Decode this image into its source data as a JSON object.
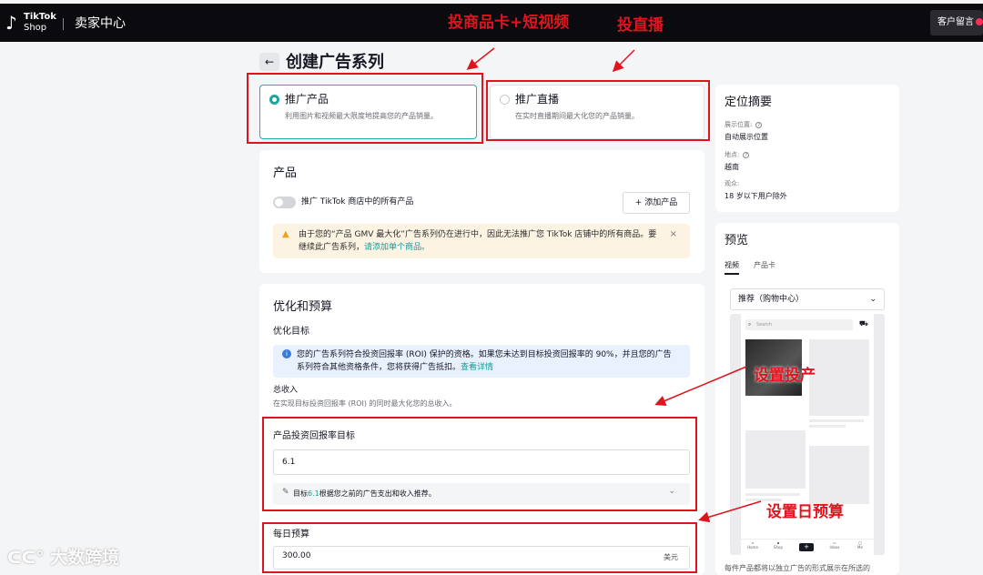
{
  "topbar": {
    "brand_top": "TikTok",
    "brand_bottom": "Shop",
    "portal": "卖家中心",
    "service": "客户留言"
  },
  "page": {
    "back_icon": "←",
    "title": "创建广告系列"
  },
  "objectives": [
    {
      "title": "推广产品",
      "desc": "利用图片和视频最大限度地提高您的产品销量。"
    },
    {
      "title": "推广直播",
      "desc": "在实时直播期间最大化您的产品销量。"
    }
  ],
  "products": {
    "title": "产品",
    "toggle_label": "推广 TikTok 商店中的所有产品",
    "add_button": "+ 添加产品",
    "warning_text": "由于您的“产品 GMV 最大化”广告系列仍在进行中，因此无法推广您 TikTok 店铺中的所有商品。要继续此广告系列，",
    "warning_link": "请添加单个商品。"
  },
  "budget": {
    "title": "优化和预算",
    "goal_label": "优化目标",
    "info_text": "您的广告系列符合投资回报率 (ROI) 保护的资格。如果您未达到目标投资回报率的 90%，并且您的广告系列符合其他资格条件，您将获得广告抵扣。",
    "info_link": "查看详情",
    "total_label": "总收入",
    "total_desc": "在实现目标投资回报率 (ROI) 的同时最大化您的总收入。",
    "roi_label": "产品投资回报率目标",
    "roi_value": "6.1",
    "rec_prefix": "目标",
    "rec_value": "6.1",
    "rec_suffix": "根据您之前的广告支出和收入推荐。",
    "daily_label": "每日预算",
    "daily_value": "300.00",
    "currency": "美元"
  },
  "summary": {
    "title": "定位摘要",
    "placement_label": "展示位置:",
    "placement_value": "自动展示位置",
    "location_label": "地点:",
    "location_value": "越南",
    "audience_label": "观众:",
    "audience_value": "18 岁以下用户除外"
  },
  "preview": {
    "title": "预览",
    "tabs": [
      "视频",
      "产品卡"
    ],
    "select_value": "推荐（购物中心）",
    "search_placeholder": "Search",
    "nav": [
      "Home",
      "Shop",
      "+",
      "Inbox",
      "Me"
    ],
    "footnote": "每件产品都将以独立广告的形式展示在所选的"
  },
  "annotations": {
    "a1": "投商品卡+短视频",
    "a2": "投直播",
    "a3": "设置投产",
    "a4": "设置日预算"
  },
  "watermark": "大数跨境",
  "colors": {
    "accent": "#20a39e",
    "annotation": "#e0141e",
    "warning_bg": "#fdf3e3",
    "info_bg": "#e8f1fd"
  }
}
